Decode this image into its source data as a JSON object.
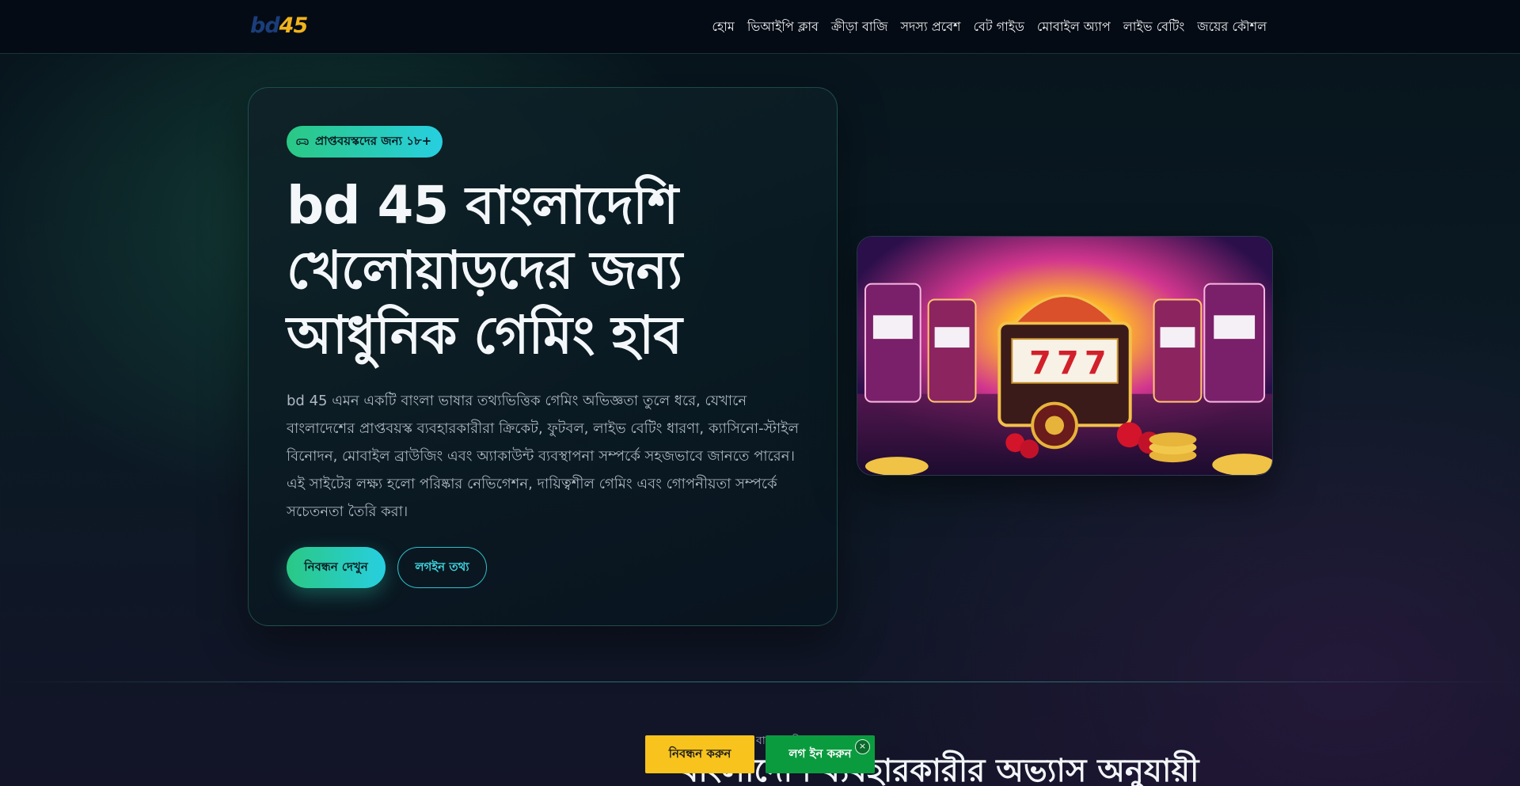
{
  "header": {
    "logo_part1": "bd",
    "logo_part2": "45",
    "nav": [
      {
        "label": "হোম"
      },
      {
        "label": "ভিআইপি ক্লাব"
      },
      {
        "label": "ক্রীড়া বাজি"
      },
      {
        "label": "সদস্য প্রবেশ"
      },
      {
        "label": "বেট গাইড"
      },
      {
        "label": "মোবাইল অ্যাপ"
      },
      {
        "label": "লাইভ বেটিং"
      },
      {
        "label": "জয়ের কৌশল"
      }
    ]
  },
  "hero": {
    "badge_icon": "gamepad-icon",
    "badge": "প্রাপ্তবয়স্কদের জন্য ১৮+",
    "title": "bd 45 বাংলাদেশি খেলোয়াড়দের জন্য আধুনিক গেমিং হাব",
    "description": "bd 45 এমন একটি বাংলা ভাষার তথ্যভিত্তিক গেমিং অভিজ্ঞতা তুলে ধরে, যেখানে বাংলাদেশের প্রাপ্তবয়স্ক ব্যবহারকারীরা ক্রিকেট, ফুটবল, লাইভ বেটিং ধারণা, ক্যাসিনো-স্টাইল বিনোদন, মোবাইল ব্রাউজিং এবং অ্যাকাউন্ট ব্যবস্থাপনা সম্পর্কে সহজভাবে জানতে পারেন। এই সাইটের লক্ষ্য হলো পরিষ্কার নেভিগেশন, দায়িত্বশীল গেমিং এবং গোপনীয়তা সম্পর্কে সচেতনতা তৈরি করা।",
    "primary_button": "নিবন্ধন দেখুন",
    "secondary_button": "লগইন তথ্য"
  },
  "section": {
    "kicker": "বাংলাদেশি",
    "title": "বাংলাদেশি ব্যবহারকারীর অভ্যাস অনুযায়ী"
  },
  "sticky_bar": {
    "register": "নিবন্ধন করুন",
    "login": "লগ ইন করুন",
    "close_icon": "close-icon",
    "close_glyph": "×"
  },
  "colors": {
    "accent_green": "#2ac884",
    "accent_cyan": "#27cfe0",
    "logo_blue": "#1b3d7a",
    "logo_gold": "#f0b31c",
    "register_yellow": "#f7c31c",
    "login_green": "#0b9b3f"
  }
}
